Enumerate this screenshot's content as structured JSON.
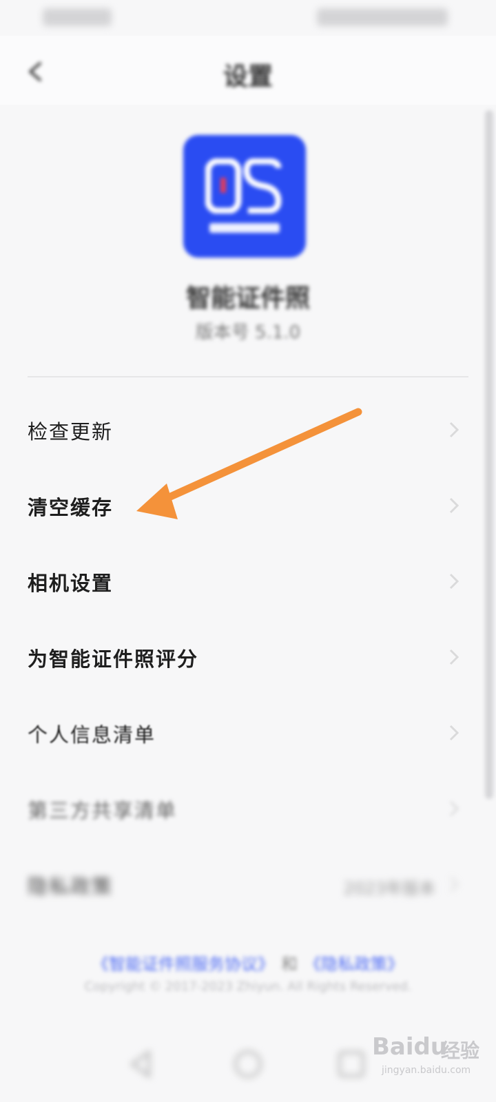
{
  "status_bar": {},
  "nav": {
    "title": "设置"
  },
  "app": {
    "name": "智能证件照",
    "version": "版本号 5.1.0"
  },
  "menu": {
    "items": [
      {
        "label": "检查更新",
        "bold": false
      },
      {
        "label": "清空缓存",
        "bold": true
      },
      {
        "label": "相机设置",
        "bold": true
      },
      {
        "label": "为智能证件照评分",
        "bold": true
      },
      {
        "label": "个人信息清单",
        "bold": false
      },
      {
        "label": "第三方共享清单",
        "bold": false
      },
      {
        "label": "隐私政策",
        "value": "2023年版本"
      }
    ]
  },
  "footer": {
    "link1": "《智能证件照服务协议》",
    "separator": "和",
    "link2": "《隐私政策》",
    "copyright": "Copyright © 2017-2023 Zhiyun. All Rights Reserved."
  },
  "watermark": {
    "brand": "Baidu",
    "brand_cn": "经验",
    "url": "jingyan.baidu.com"
  },
  "colors": {
    "accent": "#2a4cf2",
    "arrow": "#f4923a",
    "link": "#4f6cf5"
  }
}
